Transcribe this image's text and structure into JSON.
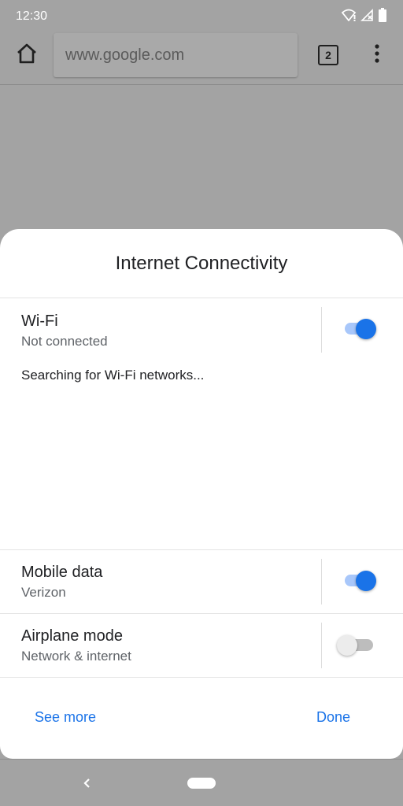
{
  "status_bar": {
    "time": "12:30",
    "icons": [
      "wifi-alert-icon",
      "signal-off-icon",
      "battery-icon"
    ]
  },
  "toolbar": {
    "home_icon": "home-icon",
    "url": "www.google.com",
    "tab_count": "2",
    "menu_icon": "more-vert-icon"
  },
  "dialog": {
    "title": "Internet Connectivity",
    "wifi": {
      "title": "Wi-Fi",
      "subtitle": "Not connected",
      "enabled": true,
      "status_message": "Searching for Wi-Fi networks..."
    },
    "mobile_data": {
      "title": "Mobile data",
      "subtitle": "Verizon",
      "enabled": true
    },
    "airplane_mode": {
      "title": "Airplane mode",
      "subtitle": "Network & internet",
      "enabled": false
    },
    "see_more_label": "See more",
    "done_label": "Done"
  },
  "colors": {
    "accent": "#1a73e8",
    "scrim": "#a3a3a3"
  },
  "nav_bar": {
    "back_icon": "back-chevron-icon",
    "home_pill": "home-pill"
  }
}
